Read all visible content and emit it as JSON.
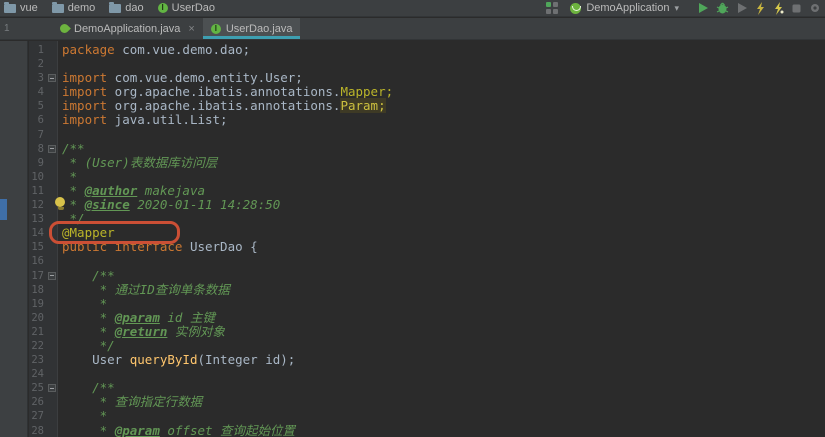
{
  "navbar": {
    "breadcrumbs": [
      {
        "label": "vue",
        "icon": "folder-icon"
      },
      {
        "label": "demo",
        "icon": "folder-icon"
      },
      {
        "label": "dao",
        "icon": "folder-icon"
      },
      {
        "label": "UserDao",
        "icon": "interface-icon"
      }
    ],
    "run_config": {
      "label": "DemoApplication",
      "caret": "▾",
      "icon": "spring-boot-icon"
    },
    "toolbar_icons": [
      "grid-icon",
      "run-icon",
      "debug-icon",
      "coverage-icon",
      "profiler-icon",
      "profiler-alt-icon",
      "stop-icon",
      "settings-icon"
    ]
  },
  "tabbar": {
    "stub": "1",
    "tabs": [
      {
        "label": "DemoApplication.java",
        "icon": "spring-leaf-icon",
        "active": false,
        "close": "×"
      },
      {
        "label": "UserDao.java",
        "icon": "interface-icon",
        "active": true
      }
    ]
  },
  "editor": {
    "fold_lines": [
      3,
      8,
      17,
      25
    ],
    "bulb_line": 12,
    "annotation_box_line": 14,
    "lines": [
      {
        "n": 1,
        "tokens": [
          [
            "kw",
            "package"
          ],
          [
            "plain",
            " com.vue.demo.dao;"
          ]
        ]
      },
      {
        "n": 2,
        "tokens": []
      },
      {
        "n": 3,
        "tokens": [
          [
            "kw",
            "import"
          ],
          [
            "plain",
            " com.vue.demo.entity.User;"
          ]
        ]
      },
      {
        "n": 4,
        "tokens": [
          [
            "kw",
            "import"
          ],
          [
            "plain",
            " org.apache.ibatis.annotations."
          ],
          [
            "ann",
            "Mapper;"
          ]
        ]
      },
      {
        "n": 5,
        "tokens": [
          [
            "kw",
            "import"
          ],
          [
            "plain",
            " org.apache.ibatis.annotations."
          ],
          [
            "annhl",
            "Param;"
          ]
        ]
      },
      {
        "n": 6,
        "tokens": [
          [
            "kw",
            "import"
          ],
          [
            "plain",
            " java.util.List;"
          ]
        ]
      },
      {
        "n": 7,
        "tokens": []
      },
      {
        "n": 8,
        "tokens": [
          [
            "cm",
            "/**"
          ]
        ]
      },
      {
        "n": 9,
        "tokens": [
          [
            "cm",
            " * (User)表数据库访问层"
          ]
        ]
      },
      {
        "n": 10,
        "tokens": [
          [
            "cm",
            " *"
          ]
        ]
      },
      {
        "n": 11,
        "tokens": [
          [
            "cm",
            " * "
          ],
          [
            "tag",
            "@author"
          ],
          [
            "cm",
            " makejava"
          ]
        ]
      },
      {
        "n": 12,
        "tokens": [
          [
            "cm",
            " * "
          ],
          [
            "tag",
            "@since"
          ],
          [
            "cm",
            " 2020-01-11 14:28:50"
          ]
        ]
      },
      {
        "n": 13,
        "tokens": [
          [
            "cm",
            " */"
          ]
        ]
      },
      {
        "n": 14,
        "tokens": [
          [
            "ann",
            "@Mapper"
          ]
        ]
      },
      {
        "n": 15,
        "tokens": [
          [
            "kw",
            "public interface"
          ],
          [
            "plain",
            " UserDao {"
          ]
        ]
      },
      {
        "n": 16,
        "tokens": []
      },
      {
        "n": 17,
        "tokens": [
          [
            "cm",
            "    /**"
          ]
        ]
      },
      {
        "n": 18,
        "tokens": [
          [
            "cm",
            "     * 通过ID查询单条数据"
          ]
        ]
      },
      {
        "n": 19,
        "tokens": [
          [
            "cm",
            "     *"
          ]
        ]
      },
      {
        "n": 20,
        "tokens": [
          [
            "cm",
            "     * "
          ],
          [
            "tag",
            "@param"
          ],
          [
            "cm",
            " id 主键"
          ]
        ]
      },
      {
        "n": 21,
        "tokens": [
          [
            "cm",
            "     * "
          ],
          [
            "tag",
            "@return"
          ],
          [
            "cm",
            " 实例对象"
          ]
        ]
      },
      {
        "n": 22,
        "tokens": [
          [
            "cm",
            "     */"
          ]
        ]
      },
      {
        "n": 23,
        "tokens": [
          [
            "plain",
            "    User "
          ],
          [
            "mth",
            "queryById"
          ],
          [
            "plain",
            "(Integer id);"
          ]
        ]
      },
      {
        "n": 24,
        "tokens": []
      },
      {
        "n": 25,
        "tokens": [
          [
            "cm",
            "    /**"
          ]
        ]
      },
      {
        "n": 26,
        "tokens": [
          [
            "cm",
            "     * 查询指定行数据"
          ]
        ]
      },
      {
        "n": 27,
        "tokens": [
          [
            "cm",
            "     *"
          ]
        ]
      },
      {
        "n": 28,
        "tokens": [
          [
            "cm",
            "     * "
          ],
          [
            "tag",
            "@param"
          ],
          [
            "cm",
            " offset 查询起始位置"
          ]
        ]
      }
    ]
  },
  "colors": {
    "accent_underline": "#3E9FB1",
    "annotation_box": "#CB4F35",
    "keyword": "#CC7832",
    "comment": "#629755",
    "annotation": "#BBB529",
    "method": "#FFC66D",
    "plain_text": "#A9B7C6",
    "editor_bg": "#2B2B2B",
    "bar_bg": "#3C3F41"
  }
}
